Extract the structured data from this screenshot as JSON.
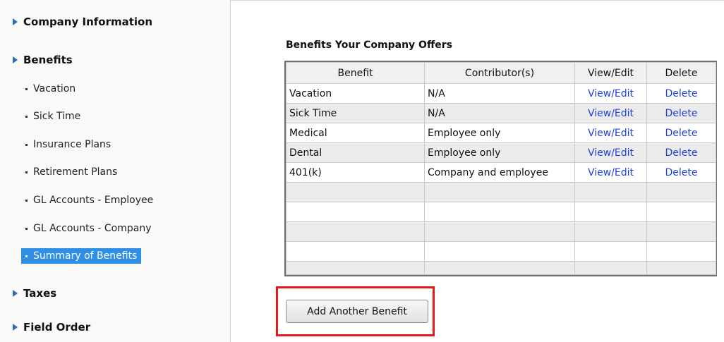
{
  "sidebar": {
    "sections": [
      {
        "label": "Company Information"
      },
      {
        "label": "Benefits"
      },
      {
        "label": "Taxes"
      },
      {
        "label": "Field Order"
      }
    ],
    "items": [
      {
        "label": "Vacation"
      },
      {
        "label": "Sick Time"
      },
      {
        "label": "Insurance Plans"
      },
      {
        "label": "Retirement Plans"
      },
      {
        "label": "GL Accounts - Employee"
      },
      {
        "label": "GL Accounts - Company"
      },
      {
        "label": "Summary of Benefits",
        "selected": true
      }
    ]
  },
  "main": {
    "heading": "Benefits Your Company Offers",
    "table": {
      "headers": [
        "Benefit",
        "Contributor(s)",
        "View/Edit",
        "Delete"
      ],
      "rows": [
        [
          "Vacation",
          "N/A",
          "View/Edit",
          "Delete"
        ],
        [
          "Sick Time",
          "N/A",
          "View/Edit",
          "Delete"
        ],
        [
          "Medical",
          "Employee only",
          "View/Edit",
          "Delete"
        ],
        [
          "Dental",
          "Employee only",
          "View/Edit",
          "Delete"
        ],
        [
          "401(k)",
          "Company and employee",
          "View/Edit",
          "Delete"
        ],
        [
          "",
          "",
          "",
          ""
        ],
        [
          "",
          "",
          "",
          ""
        ],
        [
          "",
          "",
          "",
          ""
        ],
        [
          "",
          "",
          "",
          ""
        ],
        [
          "",
          "",
          "",
          ""
        ]
      ]
    },
    "add_button": "Add Another Benefit"
  },
  "colors": {
    "selected_bg": "#2f8fe6",
    "link": "#1f3fdd",
    "highlight_box": "#e11a1a",
    "arrow": "#2a6fb8"
  }
}
